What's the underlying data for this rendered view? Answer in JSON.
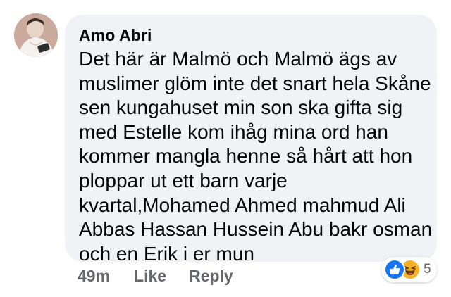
{
  "comment": {
    "author": "Amo Abri",
    "text_lines": [
      "Det här är Malmö och Malmö ägs av",
      "muslimer glöm inte det snart hela Skåne",
      "sen kungahuset min son ska gifta sig",
      "med Estelle kom ihåg mina ord han",
      "kommer mangla henne så hårt att hon",
      "ploppar ut ett barn varje",
      "kvartal,Mohamed Ahmed mahmud Ali",
      "Abbas Hassan Hussein Abu bakr osman",
      "och en Erik i er mun"
    ],
    "timestamp": "49m",
    "like_label": "Like",
    "reply_label": "Reply",
    "reactions": {
      "icons": [
        "like-icon",
        "haha-icon"
      ],
      "count": "5"
    }
  },
  "colors": {
    "bubble_bg": "#f0f2f5",
    "text": "#050505",
    "meta": "#65676b",
    "like_blue": "#1877f2",
    "haha_yellow": "#f7b125"
  }
}
